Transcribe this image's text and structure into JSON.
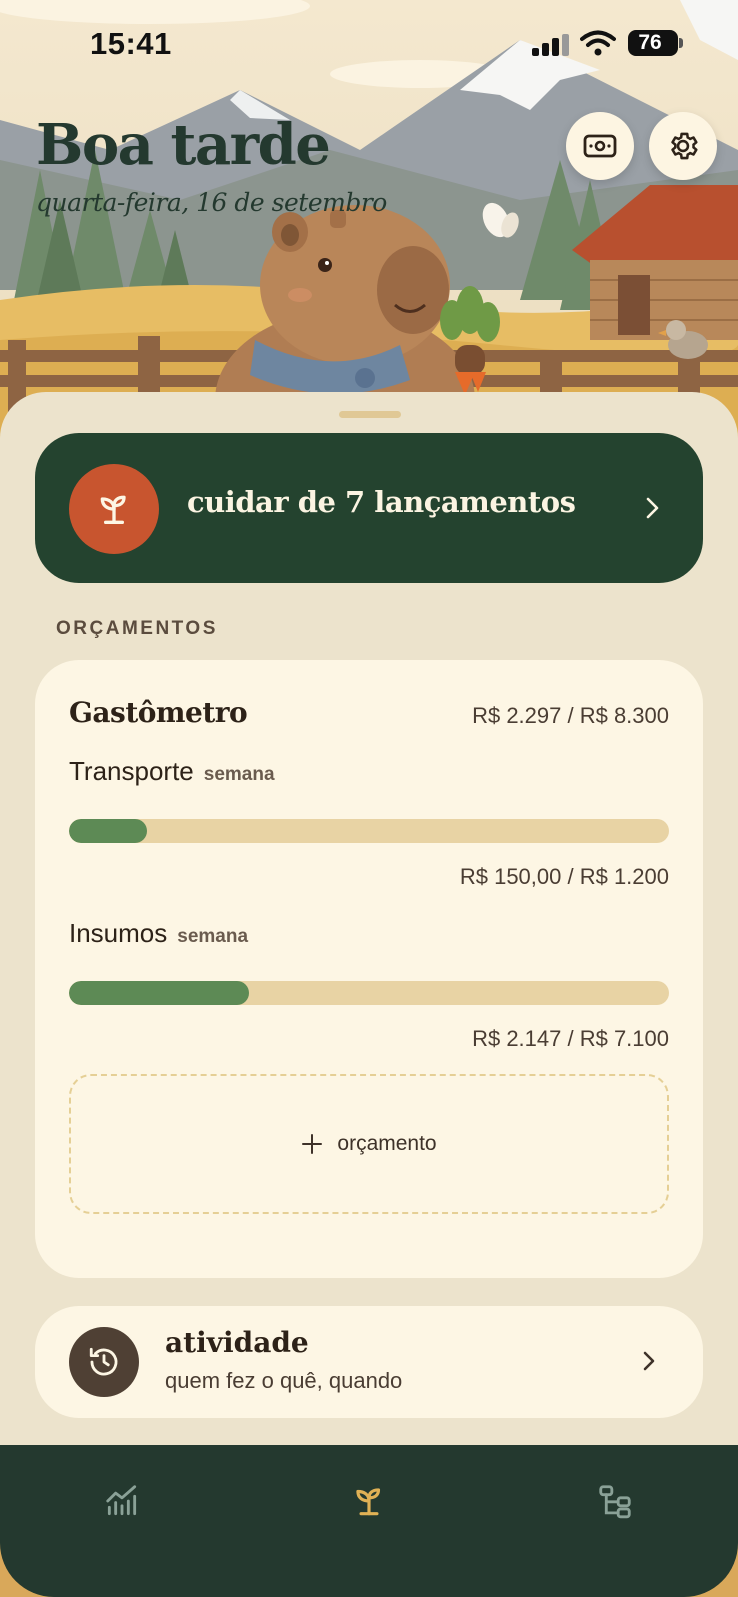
{
  "status_bar": {
    "time": "15:41",
    "battery": "76"
  },
  "header": {
    "greeting": "Boa tarde",
    "date": "quarta-feira, 16 de setembro"
  },
  "pending": {
    "label": "cuidar de 7 lançamentos"
  },
  "budgets": {
    "section_label": "ORÇAMENTOS",
    "card_title": "Gastômetro",
    "total": "R$ 2.297 / R$ 8.300",
    "items": [
      {
        "name": "Transporte",
        "period": "semana",
        "amount": "R$ 150,00 / R$ 1.200",
        "progress": 0.13
      },
      {
        "name": "Insumos",
        "period": "semana",
        "amount": "R$ 2.147 / R$ 7.100",
        "progress": 0.3
      }
    ],
    "add_label": "orçamento"
  },
  "activity": {
    "title": "atividade",
    "subtitle": "quem fez o quê, quando"
  },
  "colors": {
    "forest": "#24392f",
    "rust": "#c8552f",
    "cream": "#fdf6e4",
    "progress": "#5d8a55",
    "track": "#e8d3a4"
  },
  "icons": {
    "money": "banknote-icon",
    "settings": "gear-icon",
    "pending": "sprout-icon",
    "activity": "history-icon",
    "tabs": [
      "chart-icon",
      "sprout-icon",
      "tree-icon"
    ]
  }
}
